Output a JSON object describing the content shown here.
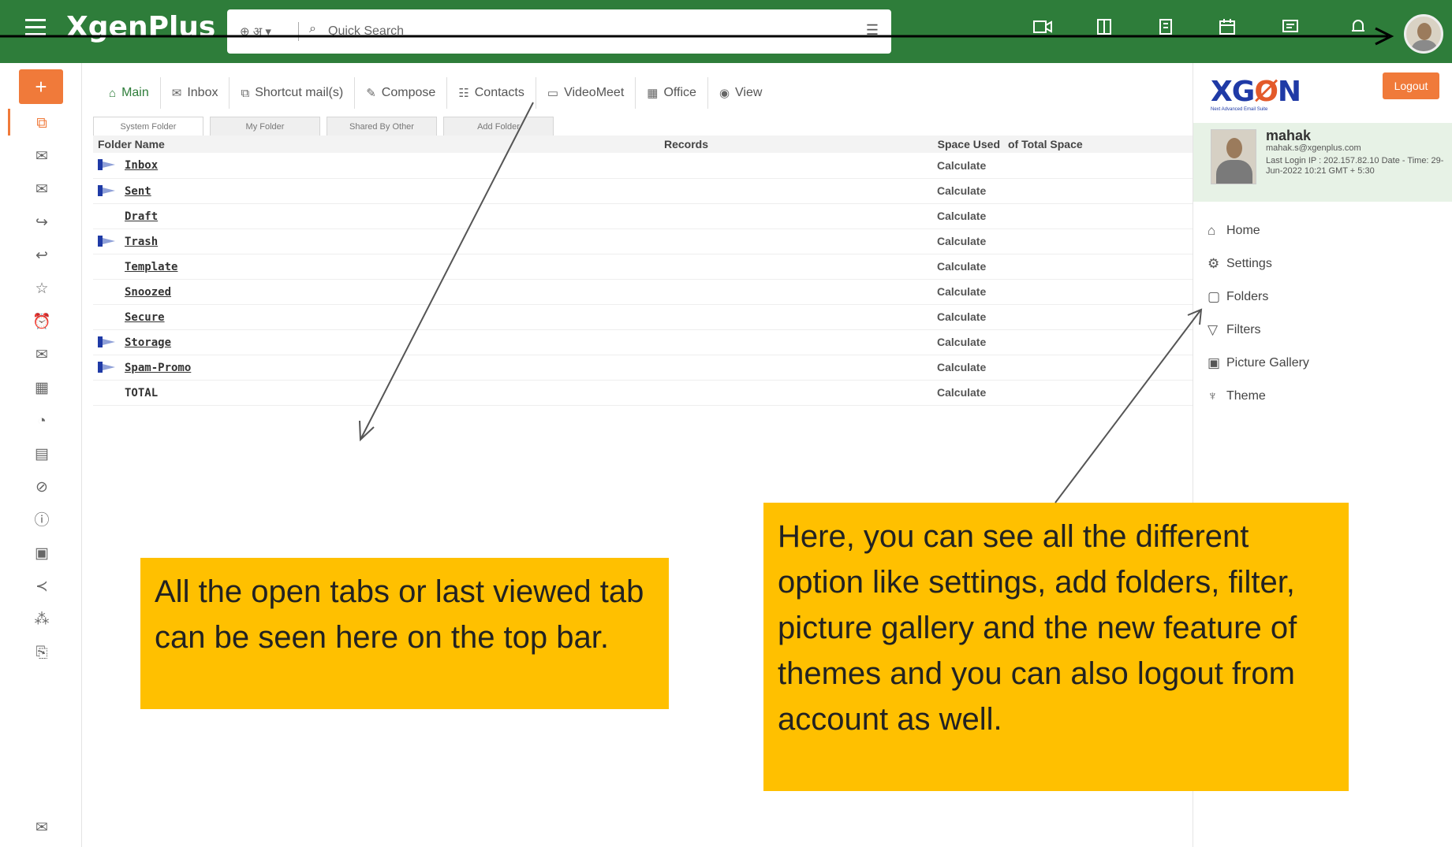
{
  "topbar": {
    "logo": "XgenPlus",
    "search_lang": "⊕ अ ▾",
    "search_placeholder": "Quick Search"
  },
  "tabs": [
    {
      "icon": "⌂",
      "label": "Main"
    },
    {
      "icon": "✉",
      "label": "Inbox"
    },
    {
      "icon": "⧉",
      "label": "Shortcut mail(s)"
    },
    {
      "icon": "✎",
      "label": "Compose"
    },
    {
      "icon": "☷",
      "label": "Contacts"
    },
    {
      "icon": "▭",
      "label": "VideoMeet"
    },
    {
      "icon": "▦",
      "label": "Office"
    },
    {
      "icon": "◉",
      "label": "View"
    }
  ],
  "subtabs": [
    "System Folder",
    "My Folder",
    "Shared By Other",
    "Add Folder"
  ],
  "table": {
    "headers": {
      "name": "Folder Name",
      "records": "Records",
      "space_used": "Space Used",
      "of_total": "of Total Space"
    },
    "rows": [
      {
        "name": "Inbox",
        "space": "Calculate"
      },
      {
        "name": "Sent",
        "space": "Calculate"
      },
      {
        "name": "Draft",
        "space": "Calculate"
      },
      {
        "name": "Trash",
        "space": "Calculate"
      },
      {
        "name": "Template",
        "space": "Calculate"
      },
      {
        "name": "Snoozed",
        "space": "Calculate"
      },
      {
        "name": "Secure",
        "space": "Calculate"
      },
      {
        "name": "Storage",
        "space": "Calculate"
      },
      {
        "name": "Spam-Promo",
        "space": "Calculate"
      },
      {
        "name": "TOTAL",
        "space": "Calculate"
      }
    ]
  },
  "rightpanel": {
    "logo_main": "XG",
    "logo_o": "Ø",
    "logo_end": "N",
    "logo_tag": "Next Advanced Email Suite",
    "logout": "Logout",
    "user": {
      "name": "mahak",
      "email": "mahak.s@xgenplus.com",
      "login_info": "Last Login IP : 202.157.82.10 Date - Time: 29-Jun-2022 10:21 GMT + 5:30"
    },
    "menu": [
      {
        "icon": "⌂",
        "label": "Home"
      },
      {
        "icon": "⚙",
        "label": "Settings"
      },
      {
        "icon": "▢",
        "label": "Folders"
      },
      {
        "icon": "▽",
        "label": "Filters"
      },
      {
        "icon": "▣",
        "label": "Picture Gallery"
      },
      {
        "icon": "♆",
        "label": "Theme"
      }
    ]
  },
  "callouts": {
    "left": "All the open tabs or last viewed tab can be seen here on the top bar.",
    "right": "Here, you can see all the different option like settings, add folders, filter, picture gallery and the new feature of themes and you can also logout from account as well."
  },
  "colors": {
    "topbar": "#2e7d3a",
    "accent": "#f07a3a",
    "callout": "#ffc000",
    "profile_bg": "#e7f2e6"
  }
}
